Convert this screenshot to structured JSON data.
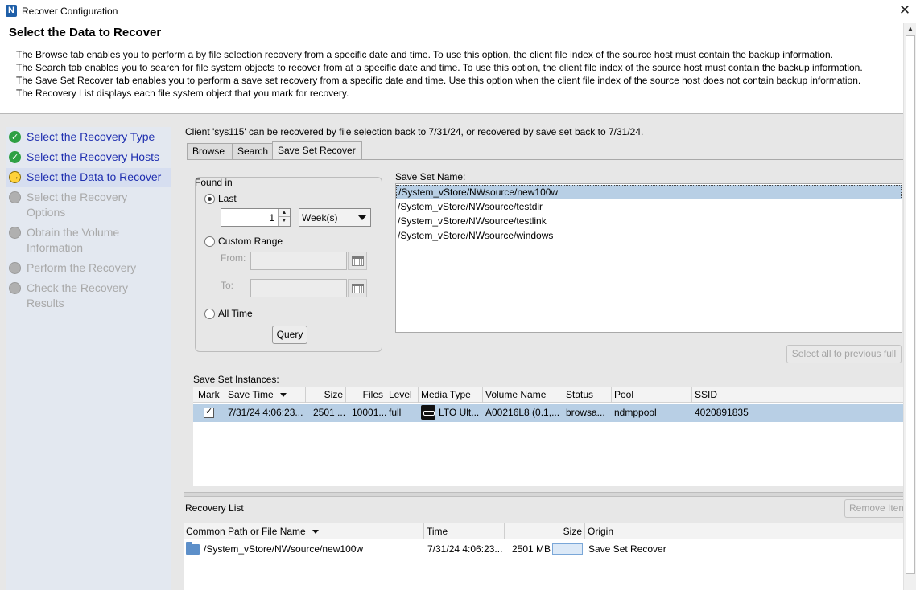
{
  "window": {
    "title": "Recover Configuration",
    "app_icon": "N",
    "close_glyph": "✕"
  },
  "header": {
    "title": "Select the Data to Recover",
    "lines": [
      "The Browse tab enables you to perform a by file selection recovery from a specific date and time. To use this option, the client file index of the source host must contain the backup information.",
      "The Search tab enables you to search for file system objects to recover from at a specific date and time. To use this option, the client file index of the source host must contain the backup information.",
      "The Save Set Recover tab enables you to perform a save set recovery from a specific date and time.  Use this option when the client file index of the source host does not contain backup information.",
      "The Recovery List displays each file system object that you mark for recovery."
    ]
  },
  "steps": [
    {
      "label": "Select the Recovery Type",
      "state": "done"
    },
    {
      "label": "Select the Recovery Hosts",
      "state": "done"
    },
    {
      "label": "Select the Data to Recover",
      "state": "active"
    },
    {
      "label": "Select the Recovery Options",
      "state": "pending"
    },
    {
      "label": "Obtain the Volume Information",
      "state": "pending"
    },
    {
      "label": "Perform the Recovery",
      "state": "pending"
    },
    {
      "label": "Check the Recovery Results",
      "state": "pending"
    }
  ],
  "client_message": "Client 'sys115' can be recovered by file selection back to 7/31/24, or recovered by save set back to 7/31/24.",
  "tabs": [
    "Browse",
    "Search",
    "Save Set Recover"
  ],
  "found_in": {
    "legend": "Found in",
    "last_label": "Last",
    "last_value": "1",
    "unit_value": "Week(s)",
    "custom_label": "Custom Range",
    "from_label": "From:",
    "to_label": "To:",
    "all_time_label": "All Time",
    "query_label": "Query"
  },
  "save_set_names": {
    "label": "Save Set Name:",
    "items": [
      "/System_vStore/NWsource/new100w",
      "/System_vStore/NWsource/testdir",
      "/System_vStore/NWsource/testlink",
      "/System_vStore/NWsource/windows"
    ],
    "select_prev_label": "Select all to previous full"
  },
  "instances": {
    "label": "Save Set Instances:",
    "columns": [
      "Mark",
      "Save Time",
      "Size",
      "Files",
      "Level",
      "Media Type",
      "Volume Name",
      "Status",
      "Pool",
      "SSID"
    ],
    "row": {
      "save_time": "7/31/24 4:06:23...",
      "size": "2501 ...",
      "files": "10001...",
      "level": "full",
      "media_type": "LTO Ult...",
      "volume_name": "A00216L8 (0.1,...",
      "status": "browsa...",
      "pool": "ndmppool",
      "ssid": "4020891835"
    }
  },
  "recovery_list": {
    "label": "Recovery List",
    "remove_label": "Remove Item",
    "columns": [
      "Common Path or File Name",
      "Time",
      "Size",
      "Origin"
    ],
    "row": {
      "path": "/System_vStore/NWsource/new100w",
      "time": "7/31/24 4:06:23...",
      "size": "2501 MB",
      "origin": "Save Set Recover"
    }
  }
}
